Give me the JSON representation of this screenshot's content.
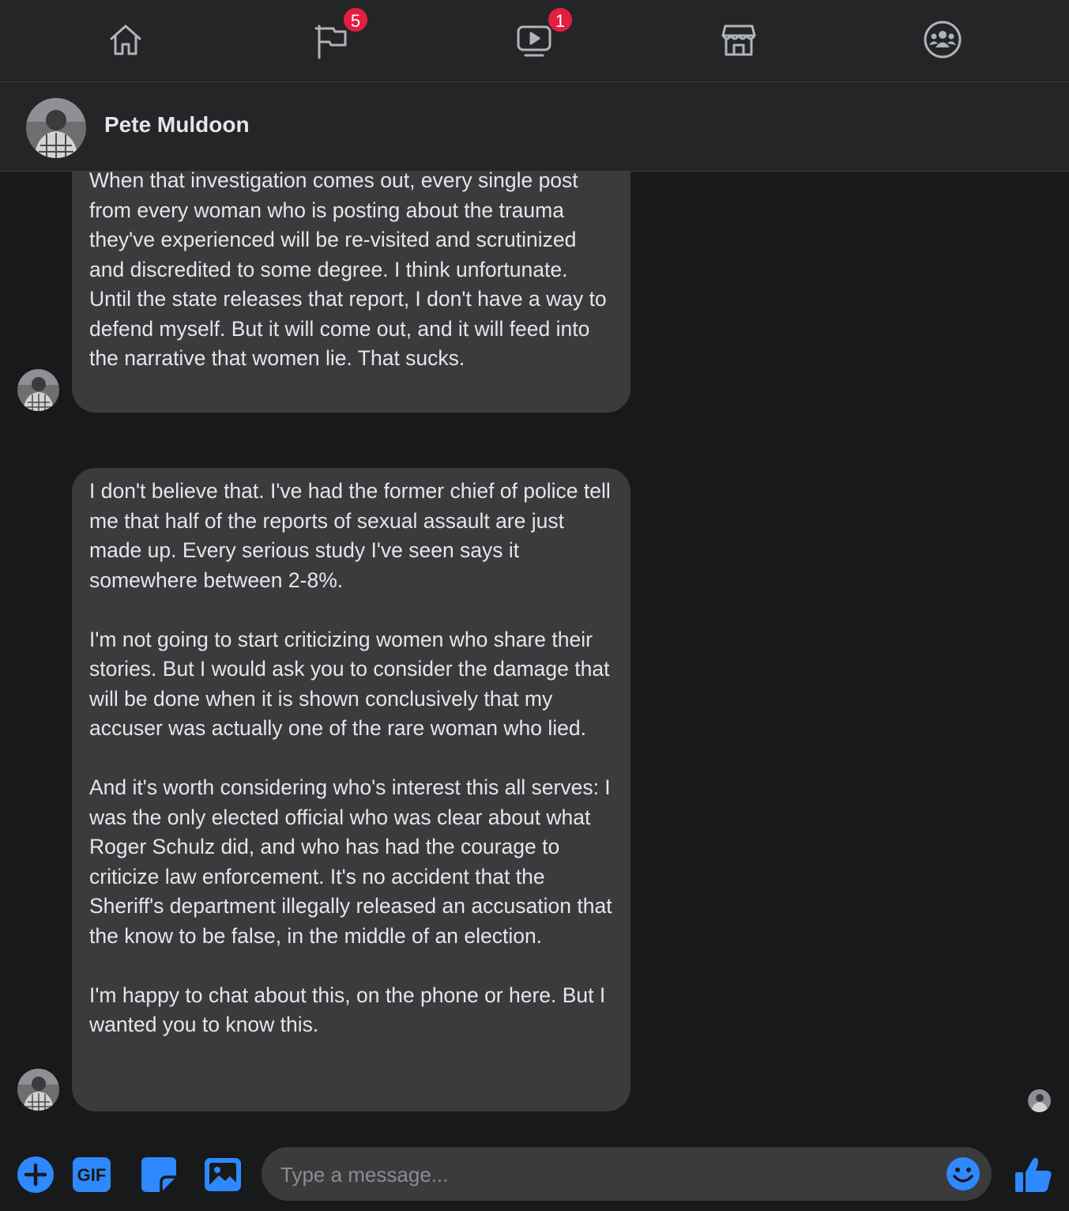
{
  "nav": {
    "items": [
      {
        "icon": "home-icon"
      },
      {
        "icon": "flag-icon",
        "badge": "5"
      },
      {
        "icon": "video-icon",
        "badge": "1"
      },
      {
        "icon": "marketplace-icon"
      },
      {
        "icon": "groups-icon"
      }
    ]
  },
  "conversation": {
    "contact_name": "Pete Muldoon"
  },
  "messages": [
    {
      "text": "When that investigation comes out, every single post from every woman who is posting about the trauma they've experienced will be re-visited and scrutinized and discredited to some degree. I think unfortunate. Until the state releases that report, I don't have a way to defend myself. But it will come out, and it will feed into the narrative that women lie. That sucks."
    },
    {
      "text": "I don't believe that. I've had the former chief of police tell me that half of the reports of sexual assault are just made up. Every serious study I've seen says it somewhere between 2-8%.\n\nI'm not going to start criticizing women who share their stories. But I would ask you to consider the damage that will be done when it is shown conclusively that my accuser was actually one of the rare woman who lied.\n\nAnd it's worth considering who's interest this all serves: I was the only elected official who was clear about what Roger Schulz did, and who has had the courage to criticize law enforcement. It's no accident that the Sheriff's department illegally released an accusation that the know to be false, in the middle of an election.\n\nI'm happy to chat about this, on the phone or here. But I wanted you to know this."
    }
  ],
  "composer": {
    "placeholder": "Type a message...",
    "gif_label": "GIF"
  },
  "colors": {
    "accent": "#2e89ff",
    "badge": "#e41e3f",
    "bubble": "#3a3b3c",
    "background": "#18191a",
    "bar": "#242526"
  }
}
